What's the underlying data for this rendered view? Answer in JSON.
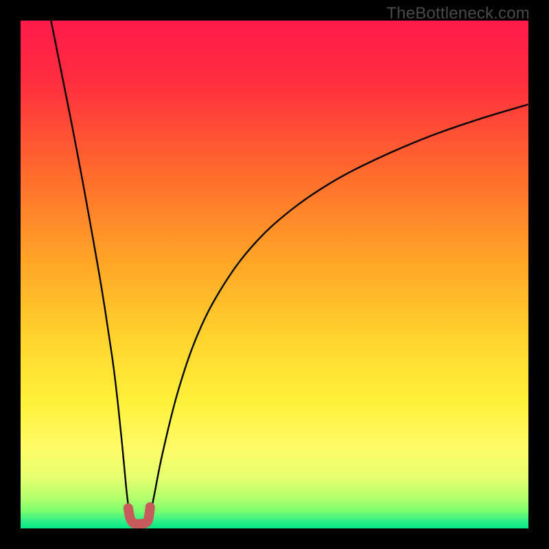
{
  "watermark": "TheBottleneck.com",
  "chart_data": {
    "type": "line",
    "title": "",
    "xlabel": "",
    "ylabel": "",
    "xlim": [
      0,
      100
    ],
    "ylim": [
      0,
      100
    ],
    "grid": false,
    "legend": "none",
    "gradient_stops": [
      {
        "offset": 0,
        "color": "#ff1a4b"
      },
      {
        "offset": 0.12,
        "color": "#ff2e3e"
      },
      {
        "offset": 0.3,
        "color": "#ff6b2d"
      },
      {
        "offset": 0.48,
        "color": "#ffa726"
      },
      {
        "offset": 0.62,
        "color": "#ffd22e"
      },
      {
        "offset": 0.75,
        "color": "#fff13a"
      },
      {
        "offset": 0.84,
        "color": "#fffb66"
      },
      {
        "offset": 0.9,
        "color": "#e6ff70"
      },
      {
        "offset": 0.94,
        "color": "#b6ff6e"
      },
      {
        "offset": 0.965,
        "color": "#7dff6d"
      },
      {
        "offset": 0.985,
        "color": "#33ef89"
      },
      {
        "offset": 1.0,
        "color": "#00e884"
      }
    ],
    "series": [
      {
        "name": "left-branch",
        "color": "#000000",
        "width": 2.4,
        "x": [
          6.0,
          8.0,
          10.0,
          12.0,
          14.0,
          16.0,
          18.0,
          19.0,
          20.0,
          20.8,
          21.4,
          21.6
        ],
        "y": [
          100.0,
          90.0,
          80.0,
          69.5,
          58.5,
          47.0,
          34.0,
          26.0,
          16.5,
          8.0,
          3.0,
          1.8
        ]
      },
      {
        "name": "right-branch",
        "color": "#000000",
        "width": 2.4,
        "x": [
          25.2,
          25.6,
          26.4,
          28.0,
          31.0,
          35.0,
          40.0,
          46.0,
          53.0,
          61.0,
          70.0,
          80.0,
          90.0,
          100.0
        ],
        "y": [
          1.8,
          3.0,
          7.0,
          15.0,
          27.0,
          38.5,
          48.0,
          56.0,
          62.5,
          68.0,
          72.7,
          77.0,
          80.5,
          83.5
        ]
      },
      {
        "name": "minimum-marker",
        "color": "#c75a5a",
        "width": 14,
        "linecap": "round",
        "x": [
          21.2,
          21.5,
          22.0,
          22.8,
          23.6,
          24.4,
          25.0,
          25.3,
          25.5
        ],
        "y": [
          4.0,
          2.3,
          1.2,
          0.9,
          0.9,
          1.0,
          1.4,
          2.5,
          4.2
        ]
      }
    ],
    "annotations": []
  }
}
